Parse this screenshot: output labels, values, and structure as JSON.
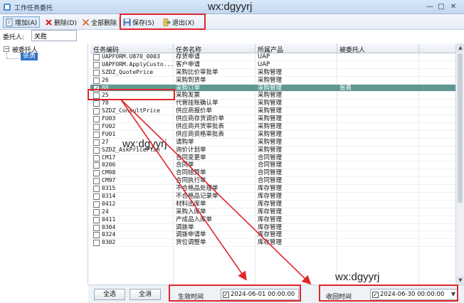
{
  "window": {
    "title": "工作任务委托",
    "min": "—",
    "max": "□",
    "close": "✕"
  },
  "watermark": "wx:dgyyrj",
  "toolbar": {
    "add": "增加(A)",
    "delete": "删除(D)",
    "delete_all": "全部删除",
    "save": "保存(S)",
    "exit": "退出(X)"
  },
  "delegator": {
    "label": "委托人:",
    "value": "关胜"
  },
  "tree": {
    "toggle": "−",
    "root": "被委托人",
    "child": "张勇"
  },
  "grid": {
    "columns": [
      "任务编码",
      "任务名称",
      "所属产品",
      "被委托人"
    ],
    "rows": [
      {
        "checked": false,
        "code": "UAPFORM.U870_0003",
        "name": "存货申请",
        "product": "UAP",
        "delegate": ""
      },
      {
        "checked": false,
        "code": "UAPFORM.ApplyCusto...",
        "name": "客户申请",
        "product": "UAP",
        "delegate": ""
      },
      {
        "checked": false,
        "code": "SZDZ_QuotePrice",
        "name": "采购比价审批单",
        "product": "采购管理",
        "delegate": ""
      },
      {
        "checked": false,
        "code": "26",
        "name": "采购到货单",
        "product": "采购管理",
        "delegate": ""
      },
      {
        "checked": true,
        "code": "88",
        "name": "采购订单",
        "product": "采购管理",
        "delegate": "张勇"
      },
      {
        "checked": false,
        "code": "25",
        "name": "采购发票",
        "product": "采购管理",
        "delegate": ""
      },
      {
        "checked": false,
        "code": "70",
        "name": "代管挂账确认单",
        "product": "采购管理",
        "delegate": ""
      },
      {
        "checked": false,
        "code": "SZDZ_ConsultPrice",
        "name": "供应商报价单",
        "product": "采购管理",
        "delegate": ""
      },
      {
        "checked": false,
        "code": "FU03",
        "name": "供应商存货调价单",
        "product": "采购管理",
        "delegate": ""
      },
      {
        "checked": false,
        "code": "FU02",
        "name": "供应商共货审批表",
        "product": "采购管理",
        "delegate": ""
      },
      {
        "checked": false,
        "code": "FU01",
        "name": "供应商资格审批表",
        "product": "采购管理",
        "delegate": ""
      },
      {
        "checked": false,
        "code": "27",
        "name": "请购单",
        "product": "采购管理",
        "delegate": ""
      },
      {
        "checked": false,
        "code": "SZDZ_AskPricePlan",
        "name": "询价计划单",
        "product": "采购管理",
        "delegate": ""
      },
      {
        "checked": false,
        "code": "CM17",
        "name": "合同变更单",
        "product": "合同管理",
        "delegate": ""
      },
      {
        "checked": false,
        "code": "0206",
        "name": "合同单",
        "product": "合同管理",
        "delegate": ""
      },
      {
        "checked": false,
        "code": "CM98",
        "name": "合同结算单",
        "product": "合同管理",
        "delegate": ""
      },
      {
        "checked": false,
        "code": "CM97",
        "name": "合同执行单",
        "product": "合同管理",
        "delegate": ""
      },
      {
        "checked": false,
        "code": "0315",
        "name": "不合格品处理单",
        "product": "库存管理",
        "delegate": ""
      },
      {
        "checked": false,
        "code": "0314",
        "name": "不合格品记录单",
        "product": "库存管理",
        "delegate": ""
      },
      {
        "checked": false,
        "code": "0412",
        "name": "材料出库单",
        "product": "库存管理",
        "delegate": ""
      },
      {
        "checked": false,
        "code": "24",
        "name": "采购入库单",
        "product": "库存管理",
        "delegate": ""
      },
      {
        "checked": false,
        "code": "0411",
        "name": "产成品入库单",
        "product": "库存管理",
        "delegate": ""
      },
      {
        "checked": false,
        "code": "0304",
        "name": "调拨单",
        "product": "库存管理",
        "delegate": ""
      },
      {
        "checked": false,
        "code": "0324",
        "name": "调拨申请单",
        "product": "库存管理",
        "delegate": ""
      },
      {
        "checked": false,
        "code": "0302",
        "name": "货位调整单",
        "product": "库存管理",
        "delegate": ""
      }
    ]
  },
  "bottom": {
    "select_all": "全选",
    "clear_all": "全消",
    "effective_label": "生效时间",
    "effective_value": "2024-06-01 00:00:00",
    "effective_checked": "✓",
    "recall_label": "收回时间",
    "recall_value": "2024-06-30 00:00:00",
    "recall_checked": "✓",
    "dropdown_arrow": "▼"
  },
  "colors": {
    "selected_row": "#5f9891",
    "annotation_red": "#e0262a",
    "tree_selected": "#3173c7"
  }
}
